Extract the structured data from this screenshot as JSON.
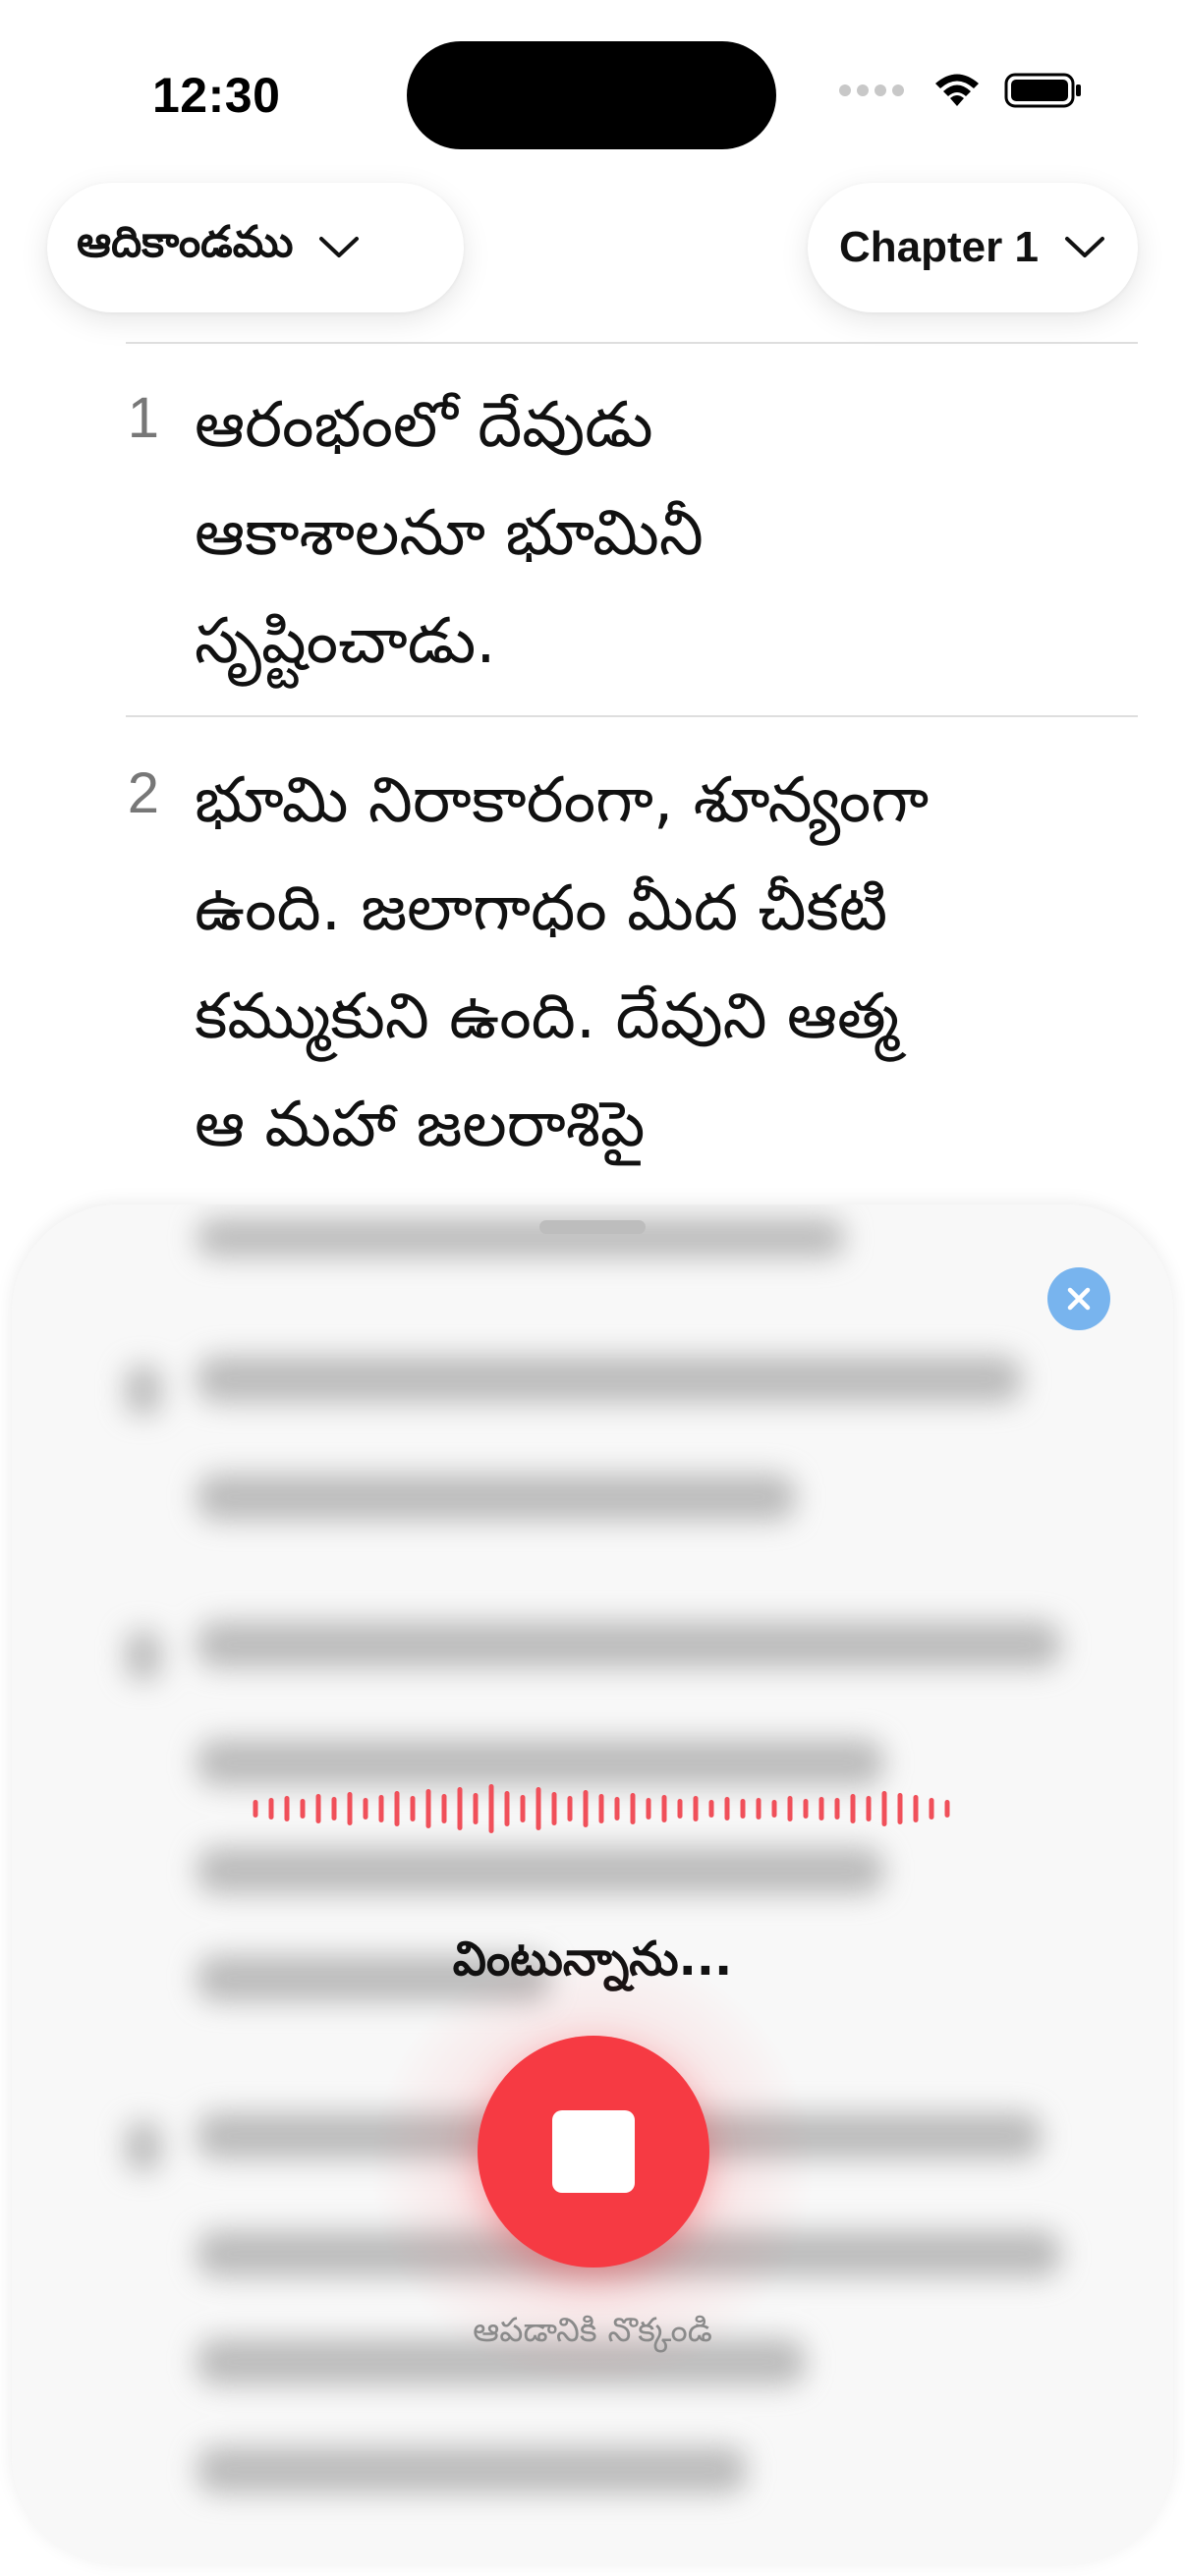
{
  "status_bar": {
    "time": "12:30"
  },
  "header": {
    "book_selector": {
      "label": "ఆదికాండము",
      "icon": "chevron-down-icon"
    },
    "chapter_selector": {
      "label": "Chapter 1",
      "icon": "chevron-down-icon"
    }
  },
  "verses": [
    {
      "number": "1",
      "lines": [
        "ఆరంభంలో దేవుడు",
        "ఆకాశాలనూ భూమినీ",
        "సృష్టించాడు."
      ]
    },
    {
      "number": "2",
      "lines": [
        "భూమి నిరాకారంగా, శూన్యంగా",
        "ఉంది. జలాగాధం మీద చీకటి",
        "కమ్ముకుని ఉంది. దేవుని ఆత్మ",
        "ఆ మహా జలరాశిపై"
      ]
    }
  ],
  "voice_sheet": {
    "close_icon": "close-icon",
    "status_text": "వింటున్నాను...",
    "stop_icon": "stop-icon",
    "hint_text": "ఆపడానికి నొక్కండి",
    "accent_color": "#f63a43",
    "close_color": "#78b4ee"
  }
}
